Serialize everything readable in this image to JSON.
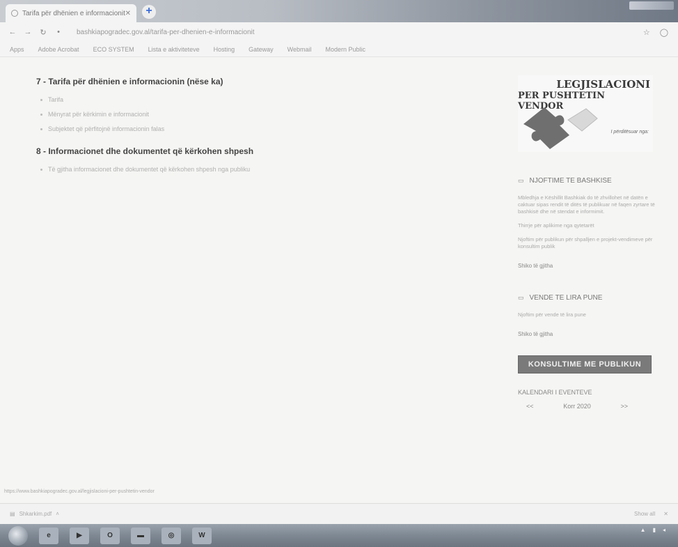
{
  "browser": {
    "tab_title": "Tarifa për dhënien e informacionit",
    "url": "bashkiapogradec.gov.al/tarifa-per-dhenien-e-informacionit",
    "bookmarks": [
      "Apps",
      "Adobe Acrobat",
      "ECO SYSTEM",
      "Lista e aktiviteteve",
      "Hosting",
      "Gateway",
      "Webmail",
      "Modern Public"
    ]
  },
  "main": {
    "section7_title": "7 - Tarifa për dhënien e informacionin (nëse ka)",
    "section7_items": [
      "Tarifa",
      "Mënyrat për kërkimin e informacionit",
      "Subjektet që përfitojnë informacionin falas"
    ],
    "section8_title": "8 - Informacionet dhe dokumentet që kërkohen shpesh",
    "section8_items": [
      "Të gjitha informacionet dhe dokumentet që kërkohen shpesh nga publiku"
    ]
  },
  "sidebar": {
    "banner_line1": "LEGJISLACIONI",
    "banner_line2": "PER PUSHTETIN VENDOR",
    "banner_sub": "I përditësuar nga:",
    "news_title": "NJOFTIME TE BASHKISE",
    "news_p1": "Mbledhja e Këshillit Bashkiak do të zhvillohet në datën e caktuar sipas rendit të ditës të publikuar në faqen zyrtare të bashkisë dhe në stendat e informimit.",
    "news_p2": "Thirrje për aplikime nga qytetarët",
    "news_p3": "Njoftim për publikun për shpalljen e projekt-vendimeve për konsultim publik",
    "news_more": "Shiko të gjitha",
    "jobs_title": "VENDE TE LIRA PUNE",
    "jobs_p1": "Njoftim për vende të lira pune",
    "jobs_more": "Shiko të gjitha",
    "consult_button": "KONSULTIME ME PUBLIKUN",
    "calendar_title": "KALENDARI I EVENTEVE",
    "calendar_prev": "<<",
    "calendar_month": "Korr 2020",
    "calendar_next": ">>"
  },
  "status": {
    "hover_url": "https://www.bashkiapogradec.gov.al/legjislacioni-per-pushtetin-vendor",
    "download_item": "Shkarkim.pdf",
    "show_all": "Show all"
  },
  "taskbar": {
    "time": "",
    "date": ""
  }
}
